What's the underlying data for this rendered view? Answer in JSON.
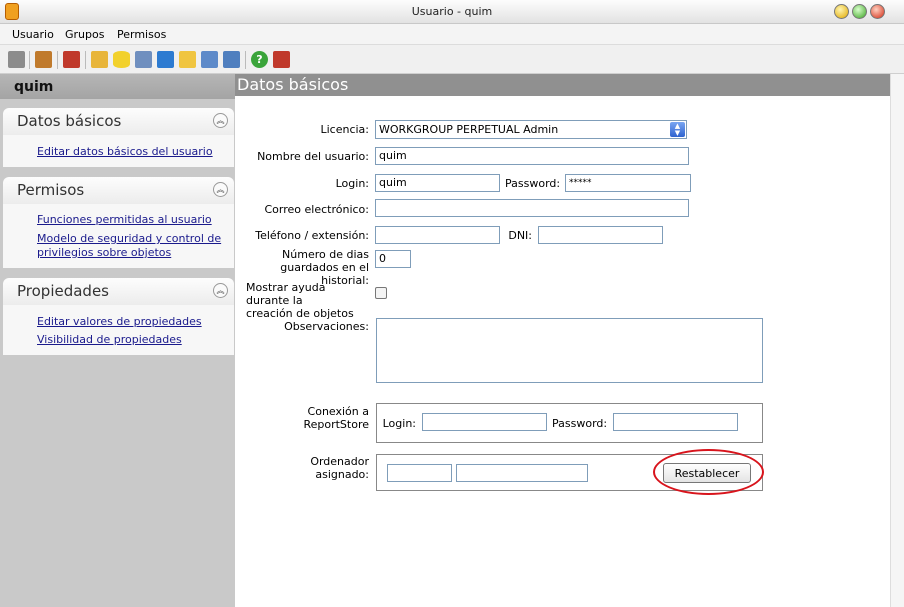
{
  "window": {
    "title": "Usuario - quim"
  },
  "menu": [
    "Usuario",
    "Grupos",
    "Permisos"
  ],
  "toolbar": {
    "icons": [
      "save-icon",
      "open-document-icon",
      "user-group-icon",
      "copy-icon",
      "database-icon",
      "windows-icon",
      "cube-icon",
      "folder-icon",
      "table-icon",
      "tools-icon",
      "help-icon",
      "exit-icon"
    ],
    "colors": [
      "#8c8c8c",
      "#c07a2c",
      "#c0392b",
      "#e8b53a",
      "#f2d12c",
      "#6f8fbf",
      "#2d7bd1",
      "#f0c540",
      "#5d8ac9",
      "#4f7fbf",
      "#3aa43a",
      "#c0392b"
    ]
  },
  "sidebar": {
    "user": "quim",
    "sections": [
      {
        "title": "Datos básicos",
        "links": [
          "Editar datos básicos del usuario"
        ]
      },
      {
        "title": "Permisos",
        "links": [
          "Funciones permitidas al usuario",
          "Modelo de seguridad y control de",
          "privilegios sobre objetos"
        ]
      },
      {
        "title": "Propiedades",
        "links": [
          "Editar valores de propiedades",
          "Visibilidad de propiedades"
        ]
      }
    ]
  },
  "content": {
    "title": "Datos básicos",
    "licencia_label": "Licencia:",
    "licencia_value": "WORKGROUP PERPETUAL Admin",
    "nombre_label": "Nombre del usuario:",
    "nombre_value": "quim",
    "login_label": "Login:",
    "login_value": "quim",
    "password_label": "Password:",
    "password_value": "*****",
    "correo_label": "Correo electrónico:",
    "correo_value": "",
    "telefono_label": "Teléfono / extensión:",
    "telefono_value": "",
    "dni_label": "DNI:",
    "dni_value": "",
    "dias_label_1": "Número de dias",
    "dias_label_2": "guardados en el historial:",
    "dias_value": "0",
    "ayuda_label_1": "Mostrar ayuda durante la",
    "ayuda_label_2": "creación de objetos",
    "ayuda_checked": false,
    "observaciones_label": "Observaciones:",
    "conexion_label_1": "Conexión a",
    "conexion_label_2": "ReportStore",
    "rs_login_label": "Login:",
    "rs_password_label": "Password:",
    "ordenador_label_1": "Ordenador",
    "ordenador_label_2": "asignado:",
    "restablecer_label": "Restablecer"
  },
  "annotation_color": "#d8141c"
}
